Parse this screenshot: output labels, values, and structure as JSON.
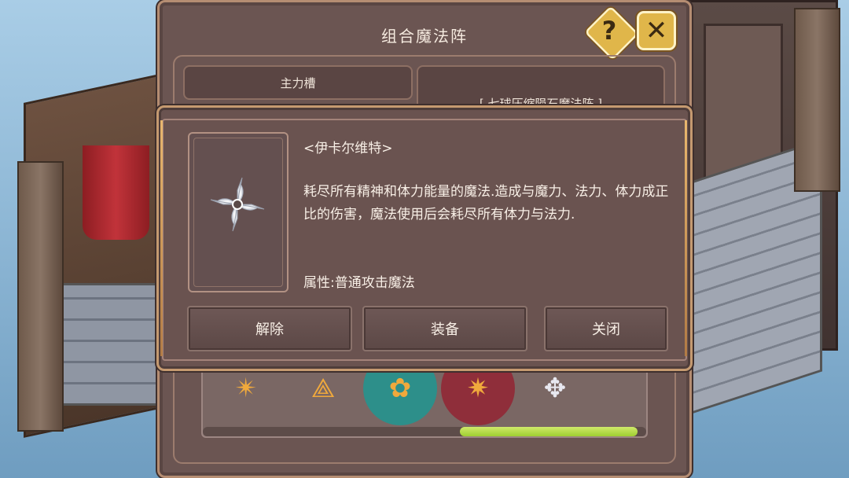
{
  "panel": {
    "title": "组合魔法阵",
    "help_label": "?",
    "close_label": "✕",
    "slot_tab_label": "主力槽",
    "array_label": "[ 七球压缩陨石魔法阵 ]"
  },
  "runes": [
    {
      "icon": "golden-star-rune-icon",
      "glyph": "✴"
    },
    {
      "icon": "golden-triangle-rune-icon",
      "glyph": "⟁"
    },
    {
      "icon": "golden-flower-rune-icon",
      "glyph": "✿"
    },
    {
      "icon": "golden-burst-rune-icon",
      "glyph": "✷"
    },
    {
      "icon": "white-swirl-rune-icon",
      "glyph": "✥"
    }
  ],
  "popup": {
    "skill_name": "<伊卡尔维特>",
    "description": "耗尽所有精神和体力能量的魔法.造成与魔力、法力、体力成正比的伤害，魔法使用后会耗尽所有体力与法力.",
    "attribute": "属性:普通攻击魔法",
    "buttons": {
      "unequip": "解除",
      "equip": "装备",
      "close": "关闭"
    }
  },
  "colors": {
    "panel_bg": "#6b5552",
    "border_gold": "#c59a70",
    "button_gold": "#e0b64a",
    "scroll_green": "#9fcf31",
    "text": "#f8efe6"
  }
}
